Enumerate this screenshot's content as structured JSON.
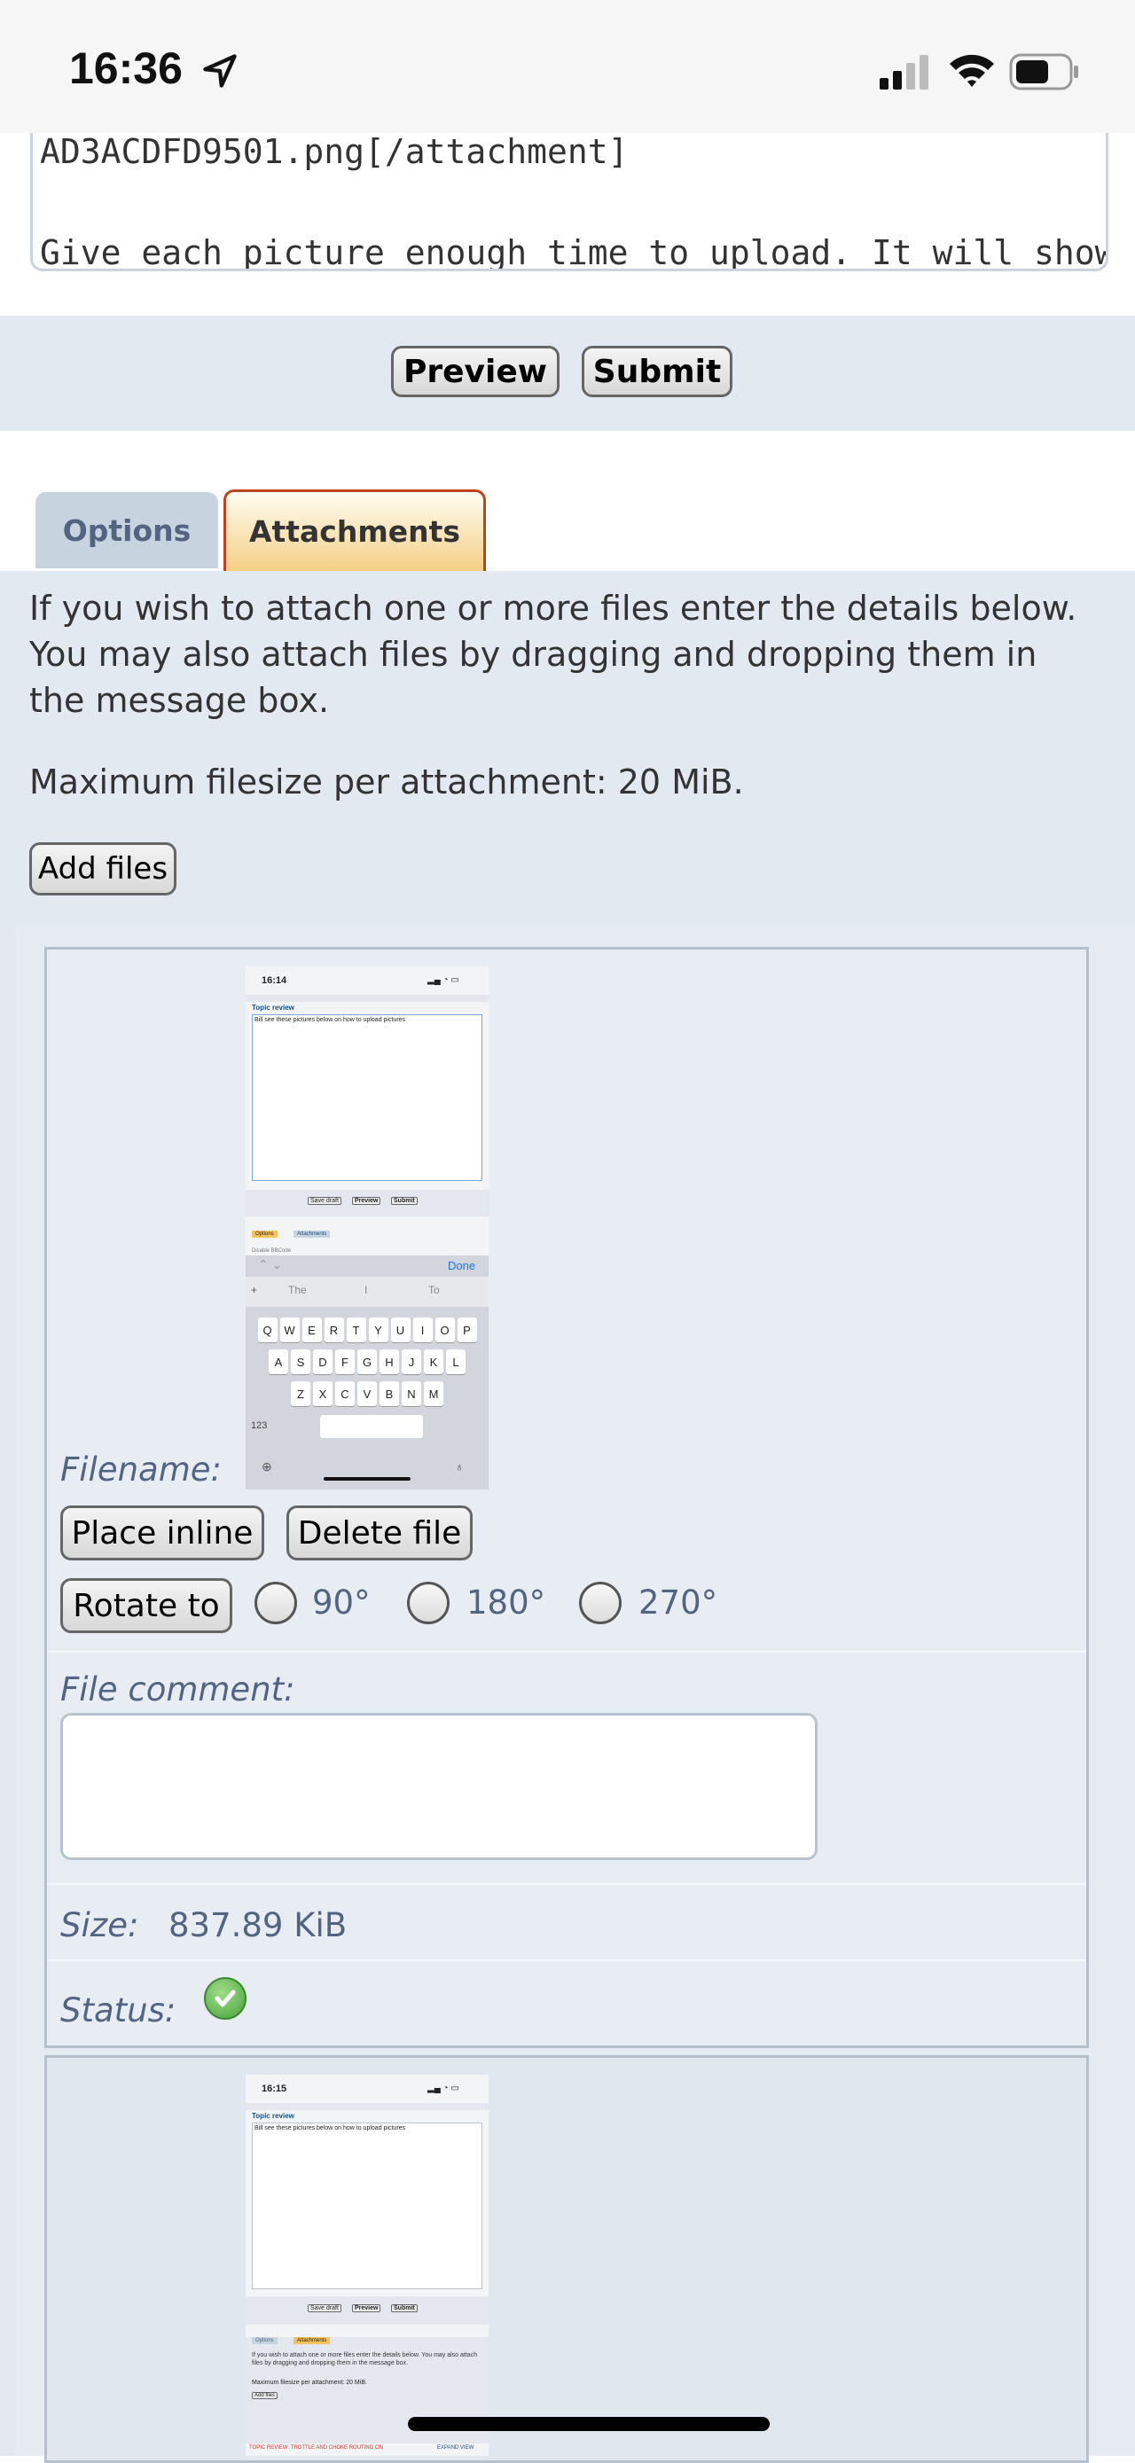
{
  "status_bar": {
    "time": "16:36",
    "location_icon": "location-arrow-icon",
    "signal_icon": "cellular-signal-icon",
    "wifi_icon": "wifi-icon",
    "battery_icon": "battery-icon"
  },
  "message": {
    "line1": "AD3ACDFD9501.png[/attachment]",
    "line2": "Give each picture enough time to upload. It will show up in a"
  },
  "actions": {
    "preview": "Preview",
    "submit": "Submit"
  },
  "tabs": [
    {
      "label": "Options"
    },
    {
      "label": "Attachments"
    }
  ],
  "panel": {
    "intro": "If you wish to attach one or more files enter the details below. You may also attach files by dragging and dropping them in the message box.",
    "max_size": "Maximum filesize per attachment: 20 MiB.",
    "add_files": "Add files"
  },
  "files": [
    {
      "filename_label": "Filename:",
      "place_inline": "Place inline",
      "delete_file": "Delete file",
      "rotate_to": "Rotate to",
      "rotations": [
        "90°",
        "180°",
        "270°"
      ],
      "comment_label": "File comment:",
      "size_label": "Size:",
      "size_value": "837.89 KiB",
      "status_label": "Status:",
      "status_icon": "check-circle-icon",
      "thumbnail": {
        "time": "16:14",
        "title": "Topic review",
        "text": "Bill see these pictures below on how to upload pictures",
        "buttons": [
          "Save draft",
          "Preview",
          "Submit"
        ],
        "tabs": [
          "Options",
          "Attachments"
        ],
        "checkbox": "Disable BBCode",
        "done": "Done",
        "suggestions": [
          "The",
          "I",
          "To"
        ],
        "keys_row1": [
          "Q",
          "W",
          "E",
          "R",
          "T",
          "Y",
          "U",
          "I",
          "O",
          "P"
        ],
        "keys_row2": [
          "A",
          "S",
          "D",
          "F",
          "G",
          "H",
          "J",
          "K",
          "L"
        ],
        "keys_row3": [
          "Z",
          "X",
          "C",
          "V",
          "B",
          "N",
          "M"
        ],
        "num_key": "123"
      }
    },
    {
      "thumbnail": {
        "time": "16:15",
        "title": "Topic review",
        "text": "Bill see these pictures below on how to upload pictures",
        "buttons": [
          "Save draft",
          "Preview",
          "Submit"
        ],
        "tabs": [
          "Options",
          "Attachments"
        ],
        "intro": "If you wish to attach one or more files enter the details below. You may also attach files by dragging and dropping them in the message box.",
        "max_size": "Maximum filesize per attachment: 20 MiB.",
        "add_files": "Add files",
        "footer_left": "TOPIC REVIEW: TROTTLE AND CHOKE ROUTING ON",
        "footer_right": "EXPAND VIEW"
      }
    }
  ]
}
